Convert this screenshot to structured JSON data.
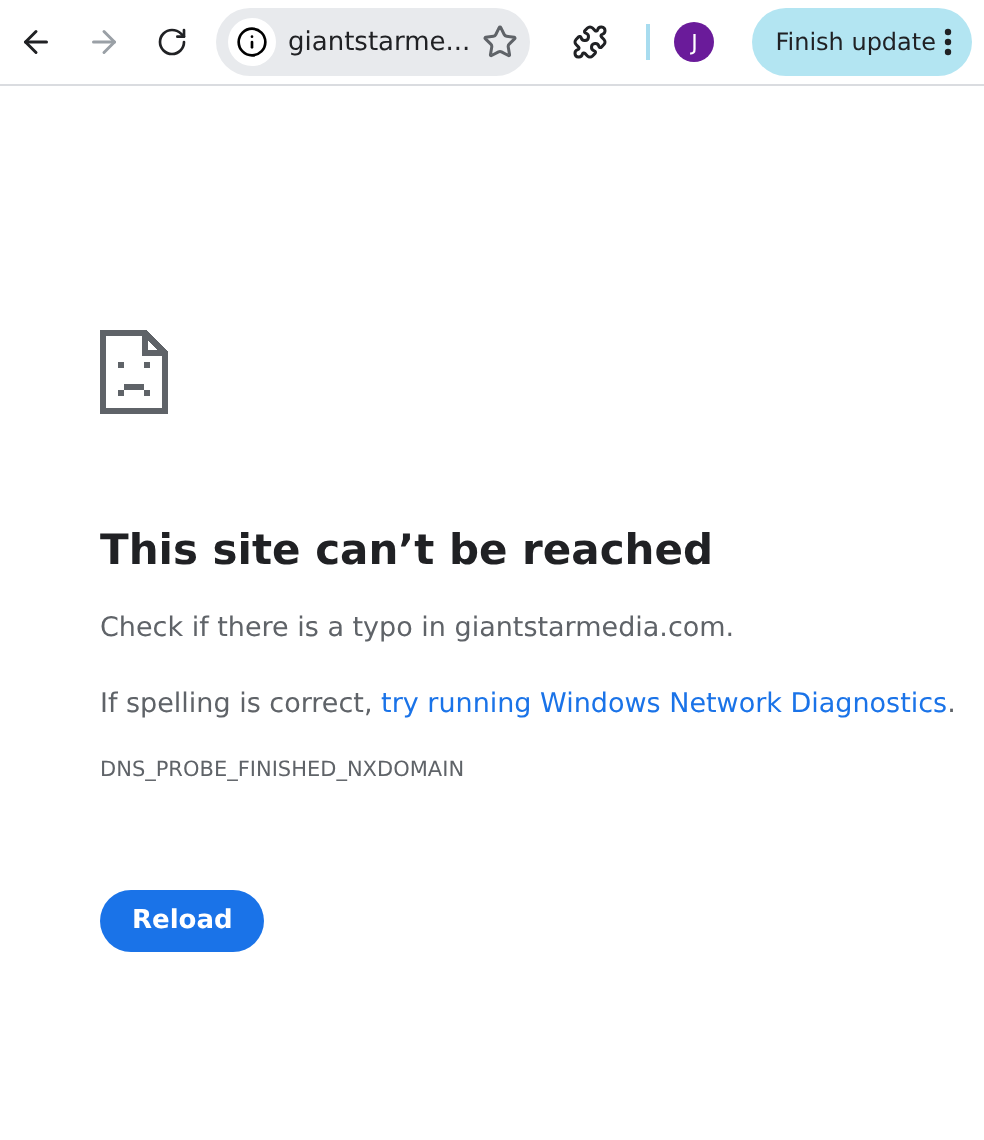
{
  "toolbar": {
    "back": {
      "disabled": false
    },
    "forward": {
      "disabled": true
    },
    "address": "giantstarme...",
    "profile_initial": "J",
    "update_button": "Finish update"
  },
  "error": {
    "title": "This site can’t be reached",
    "hint": "Check if there is a typo in giantstarmedia.com.",
    "suggestion_prefix": "If spelling is correct, ",
    "suggestion_link": "try running Windows Network Diagnostics",
    "suggestion_suffix": ".",
    "code": "DNS_PROBE_FINISHED_NXDOMAIN",
    "button": "Reload"
  }
}
